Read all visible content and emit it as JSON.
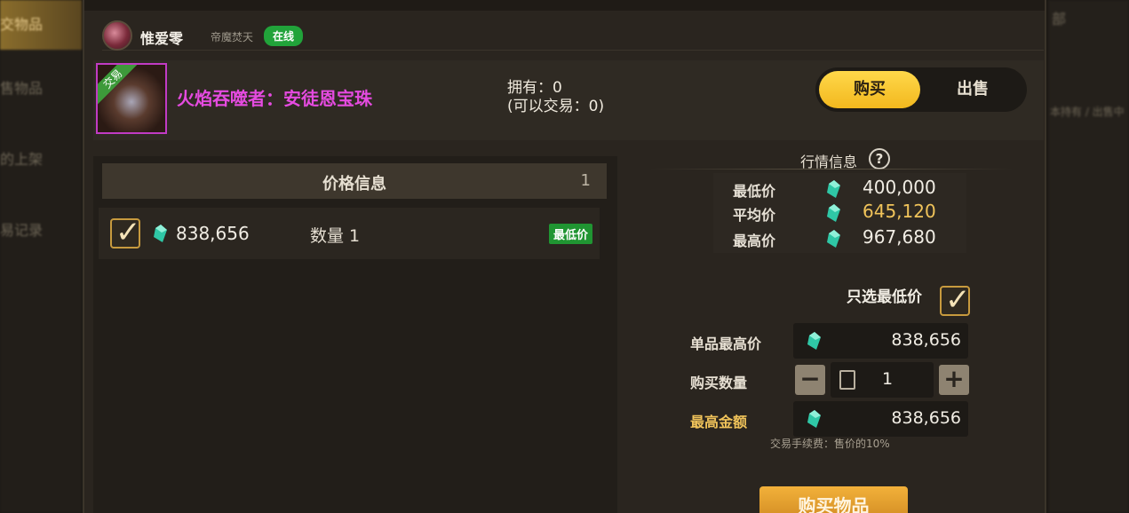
{
  "sidebar": {
    "tabs": [
      {
        "label": "交物品",
        "active": true
      },
      {
        "label": "售物品",
        "active": false
      },
      {
        "label": "的上架",
        "active": false
      },
      {
        "label": "易记录",
        "active": false
      }
    ]
  },
  "right_bg": {
    "top": "部",
    "links": "本持有 / 出售中"
  },
  "user": {
    "name": "惟爱零",
    "server": "帝魔焚天",
    "status": "在线"
  },
  "item": {
    "badge": "交易",
    "name": "火焰吞噬者：安徒恩宝珠",
    "owned_line1": "拥有：0",
    "owned_line2": "(可以交易：0)",
    "name_color": "#e54be0"
  },
  "mode_toggle": {
    "buy": "购买",
    "sell": "出售",
    "selected": "buy"
  },
  "price_list": {
    "header": "价格信息",
    "count": "1",
    "entries": [
      {
        "checked": true,
        "price": "838,656",
        "quantity": "数量 1",
        "tag": "最低价"
      }
    ]
  },
  "market": {
    "title": "行情信息",
    "help_icon": "question-icon",
    "rows": [
      {
        "label": "最低价",
        "value": "400,000"
      },
      {
        "label": "平均价",
        "value": "645,120"
      },
      {
        "label": "最高价",
        "value": "967,680"
      }
    ]
  },
  "purchase": {
    "only_lowest_label": "只选最低价",
    "only_lowest_checked": true,
    "max_unit_label": "单品最高价",
    "max_unit_value": "838,656",
    "quantity_label": "购买数量",
    "quantity_value": "1",
    "max_total_label": "最高金额",
    "max_total_value": "838,656",
    "fee_note": "交易手续费：售价的10%",
    "buy_button": "购买物品"
  },
  "colors": {
    "accent_gold": "#f2b81e",
    "online_green": "#21a33a",
    "gem": "#2fc7a6"
  }
}
